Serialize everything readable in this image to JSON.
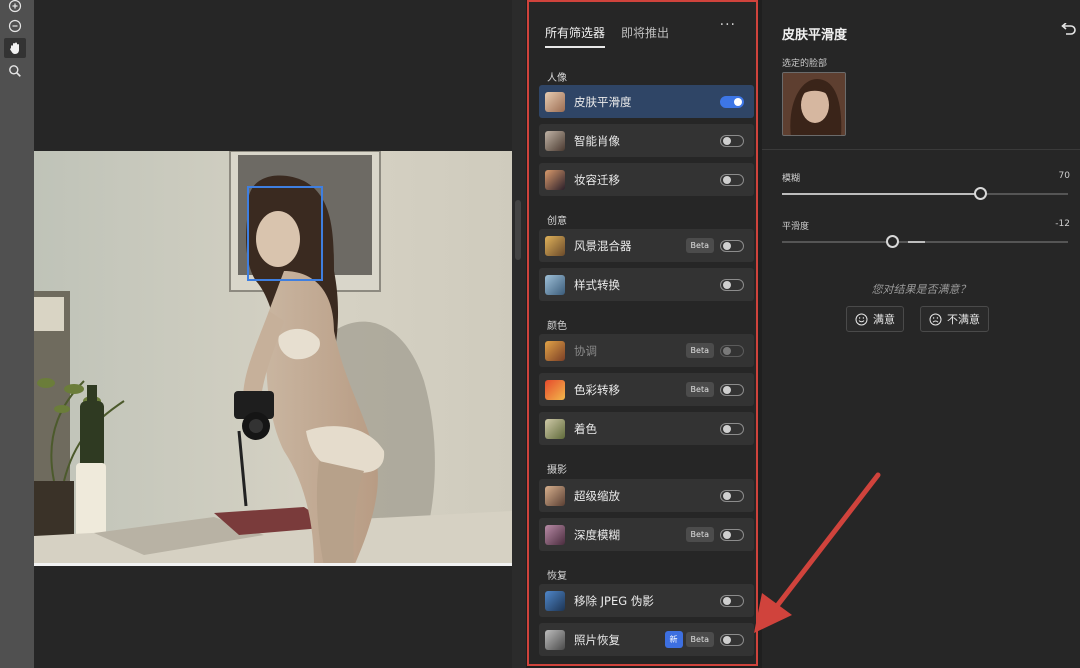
{
  "tools": [
    "zoom-in-icon",
    "zoom-out-icon",
    "hand-icon",
    "search-icon"
  ],
  "filters": {
    "tabs": [
      "所有筛选器",
      "即将推出"
    ],
    "more_label": "···",
    "sections": [
      {
        "title": "人像",
        "items": [
          {
            "label": "皮肤平滑度",
            "enabled": true,
            "selected": true
          },
          {
            "label": "智能肖像",
            "enabled": false
          },
          {
            "label": "妆容迁移",
            "enabled": false
          }
        ]
      },
      {
        "title": "创意",
        "items": [
          {
            "label": "风景混合器",
            "beta": "Beta",
            "enabled": false
          },
          {
            "label": "样式转换",
            "enabled": false
          }
        ]
      },
      {
        "title": "颜色",
        "items": [
          {
            "label": "协调",
            "beta": "Beta",
            "enabled": false,
            "disabled": true
          },
          {
            "label": "色彩转移",
            "beta": "Beta",
            "enabled": false
          },
          {
            "label": "着色",
            "enabled": false
          }
        ]
      },
      {
        "title": "摄影",
        "items": [
          {
            "label": "超级缩放",
            "enabled": false
          },
          {
            "label": "深度模糊",
            "beta": "Beta",
            "enabled": false
          }
        ]
      },
      {
        "title": "恢复",
        "items": [
          {
            "label": "移除 JPEG 伪影",
            "enabled": false
          },
          {
            "label": "照片恢复",
            "new": "新",
            "beta": "Beta",
            "enabled": false
          }
        ]
      }
    ]
  },
  "settings": {
    "title": "皮肤平滑度",
    "selected_face_label": "选定的脸部",
    "sliders": [
      {
        "label": "模糊",
        "value": "70",
        "fraction": 0.7,
        "min": 0,
        "max": 100
      },
      {
        "label": "平滑度",
        "value": "-12",
        "fraction": -0.12,
        "min": -100,
        "max": 100
      }
    ],
    "question": "您对结果是否满意？",
    "satisfied_label": "满意",
    "unsatisfied_label": "不满意"
  },
  "colors": {
    "accent": "#3d76e6",
    "annotation_red": "#d0433c",
    "face_box": "#3f7fe0"
  }
}
